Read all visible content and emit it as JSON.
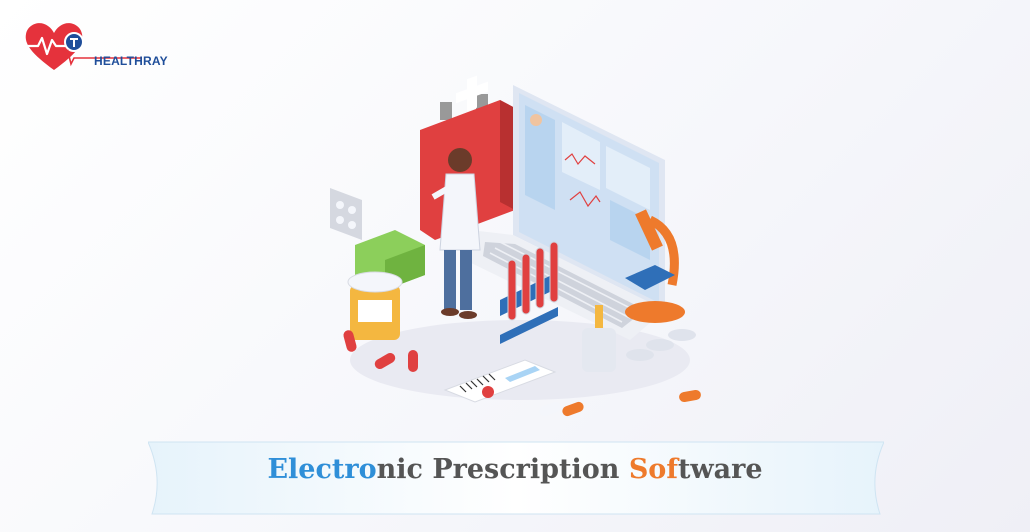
{
  "brand": {
    "name": "HEALTHRAY",
    "colors": {
      "heart": "#e5323c",
      "text": "#1f4e9a",
      "accent_blue": "#2f8fd8",
      "accent_orange": "#ee7a2c"
    }
  },
  "illustration": {
    "icons": [
      "first-aid-kit-icon",
      "laptop-icon",
      "doctor-figure-icon",
      "test-tubes-icon",
      "microscope-icon",
      "medicine-bottle-icon",
      "pill-capsules-icon",
      "barcode-label-icon"
    ]
  },
  "title": {
    "part1": "Electro",
    "part2": "nic Prescription ",
    "part3": "Sof",
    "part4": "tware"
  }
}
